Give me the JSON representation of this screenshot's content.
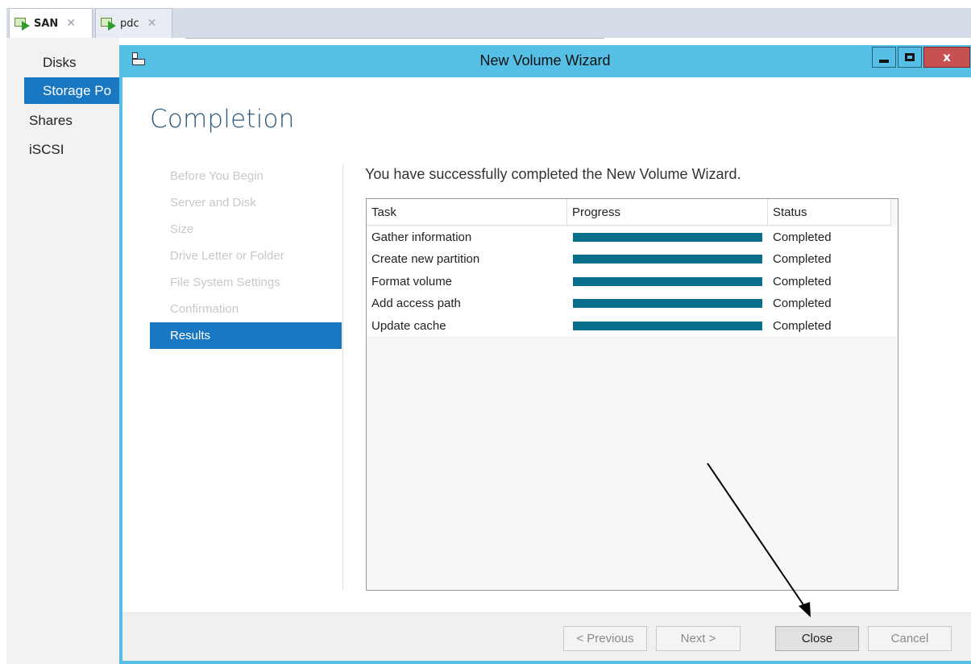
{
  "tabs": [
    {
      "label": "SAN",
      "icon": "vm-connect-icon",
      "close": "✕"
    },
    {
      "label": "pdc",
      "icon": "vm-connect-icon",
      "close": "✕"
    }
  ],
  "background_nav": {
    "items": [
      "Disks",
      "Storage Po",
      "Shares",
      "iSCSI"
    ],
    "selected": "Storage Po"
  },
  "wizard": {
    "title": "New Volume Wizard",
    "close_glyph": "x",
    "heading": "Completion",
    "steps": [
      "Before You Begin",
      "Server and Disk",
      "Size",
      "Drive Letter or Folder",
      "File System Settings",
      "Confirmation",
      "Results"
    ],
    "active_step": "Results",
    "success_message": "You have successfully completed the New Volume Wizard.",
    "results": {
      "columns": [
        "Task",
        "Progress",
        "Status"
      ],
      "rows": [
        {
          "task": "Gather information",
          "progress_fraction": 1.0,
          "status": "Completed"
        },
        {
          "task": "Create new partition",
          "progress_fraction": 1.0,
          "status": "Completed"
        },
        {
          "task": "Format volume",
          "progress_fraction": 1.0,
          "status": "Completed"
        },
        {
          "task": "Add access path",
          "progress_fraction": 1.0,
          "status": "Completed"
        },
        {
          "task": "Update cache",
          "progress_fraction": 1.0,
          "status": "Completed"
        }
      ]
    },
    "buttons": {
      "previous": "< Previous",
      "next": "Next >",
      "close": "Close",
      "cancel": "Cancel"
    }
  },
  "colors": {
    "accent": "#1a78c2",
    "titlebar": "#56bfe6",
    "progress": "#0a6f8d",
    "close_window": "#c75050"
  }
}
